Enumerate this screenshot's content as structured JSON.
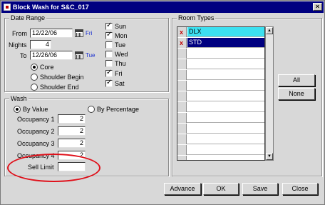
{
  "window": {
    "title": "Block Wash for S&C_017",
    "close_glyph": "×"
  },
  "date_range": {
    "group_title": "Date Range",
    "from_label": "From",
    "from_value": "12/22/06",
    "from_dow": "Fri",
    "nights_label": "Nights",
    "nights_value": "4",
    "to_label": "To",
    "to_value": "12/26/06",
    "to_dow": "Tue",
    "modes": [
      {
        "label": "Core",
        "checked": true
      },
      {
        "label": "Shoulder Begin",
        "checked": false
      },
      {
        "label": "Shoulder End",
        "checked": false
      }
    ],
    "days": [
      {
        "label": "Sun",
        "checked": true
      },
      {
        "label": "Mon",
        "checked": true
      },
      {
        "label": "Tue",
        "checked": false
      },
      {
        "label": "Wed",
        "checked": false
      },
      {
        "label": "Thu",
        "checked": false
      },
      {
        "label": "Fri",
        "checked": true
      },
      {
        "label": "Sat",
        "checked": true
      }
    ]
  },
  "wash": {
    "group_title": "Wash",
    "by_value_label": "By Value",
    "by_percentage_label": "By Percentage",
    "selected": "By Value",
    "occupancy": [
      {
        "label": "Occupancy 1",
        "value": "2"
      },
      {
        "label": "Occupancy 2",
        "value": "2"
      },
      {
        "label": "Occupancy 3",
        "value": "2"
      },
      {
        "label": "Occupancy 4",
        "value": "2"
      }
    ],
    "sell_limit_label": "Sell Limit",
    "sell_limit_value": ""
  },
  "room_types": {
    "group_title": "Room Types",
    "rows": [
      {
        "marked": "x",
        "code": "DLX",
        "state": "current",
        "bg": "#3ce0f0",
        "fg": "#000000"
      },
      {
        "marked": "x",
        "code": "STD",
        "state": "selected",
        "bg": "#000080",
        "fg": "#ffffff"
      }
    ],
    "all_label": "All",
    "none_label": "None"
  },
  "buttons": {
    "advance": "Advance",
    "ok": "OK",
    "save": "Save",
    "close": "Close"
  },
  "annotation": {
    "color": "#e0101a",
    "target": "Sell Limit"
  }
}
